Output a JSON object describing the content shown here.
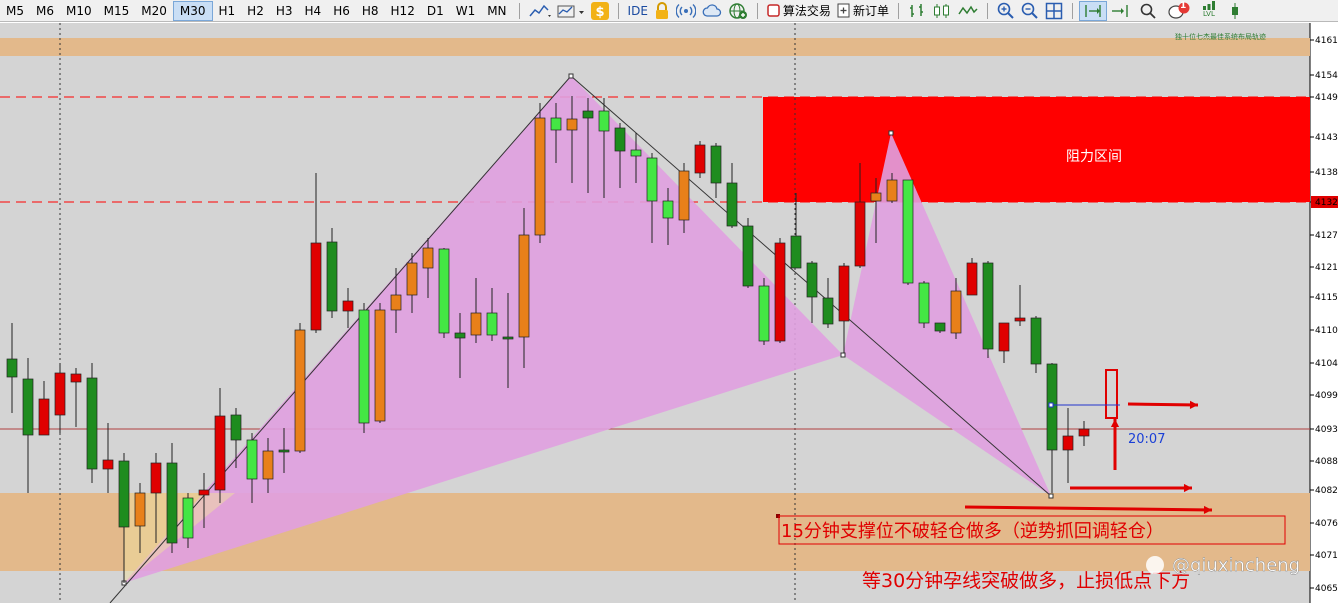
{
  "toolbar": {
    "timeframes": [
      "M5",
      "M6",
      "M10",
      "M15",
      "M20",
      "M30",
      "H1",
      "H2",
      "H3",
      "H4",
      "H6",
      "H8",
      "H12",
      "D1",
      "W1",
      "MN"
    ],
    "active_timeframe": "M30",
    "ide_label": "IDE",
    "algo_trading_label": "算法交易",
    "new_order_label": "新订单",
    "notification_count": "1",
    "lvl_label": "LVL"
  },
  "chart": {
    "header_text": "独十位七杰最佳系统布局轨迹",
    "price_ticks": [
      "4161",
      "4154",
      "4149",
      "4143",
      "4138",
      "4132",
      "4127",
      "4121",
      "4115",
      "4110",
      "4104",
      "4099",
      "4093",
      "4088",
      "4082",
      "4076",
      "4071",
      "4065"
    ],
    "current_price": "4092",
    "resistance_top_price": "4150",
    "resistance_bottom_price": "4132",
    "resistance_label": "阻力区间",
    "time_label": "20:07",
    "annotation_1": "15分钟支撑位不破轻仓做多（逆势抓回调轻仓）",
    "annotation_2": "等30分钟孕线突破做多，止损低点下方",
    "watermark": "@qiuxincheng",
    "colors": {
      "bg": "#d4d4d4",
      "bull": "#1e8c1e",
      "bear": "#e00000",
      "orange": "#e8801a",
      "lime": "#44e644",
      "pattern": "#e0a0e0",
      "zone_tan": "#e3b98b",
      "resistance": "#ff0000"
    }
  }
}
